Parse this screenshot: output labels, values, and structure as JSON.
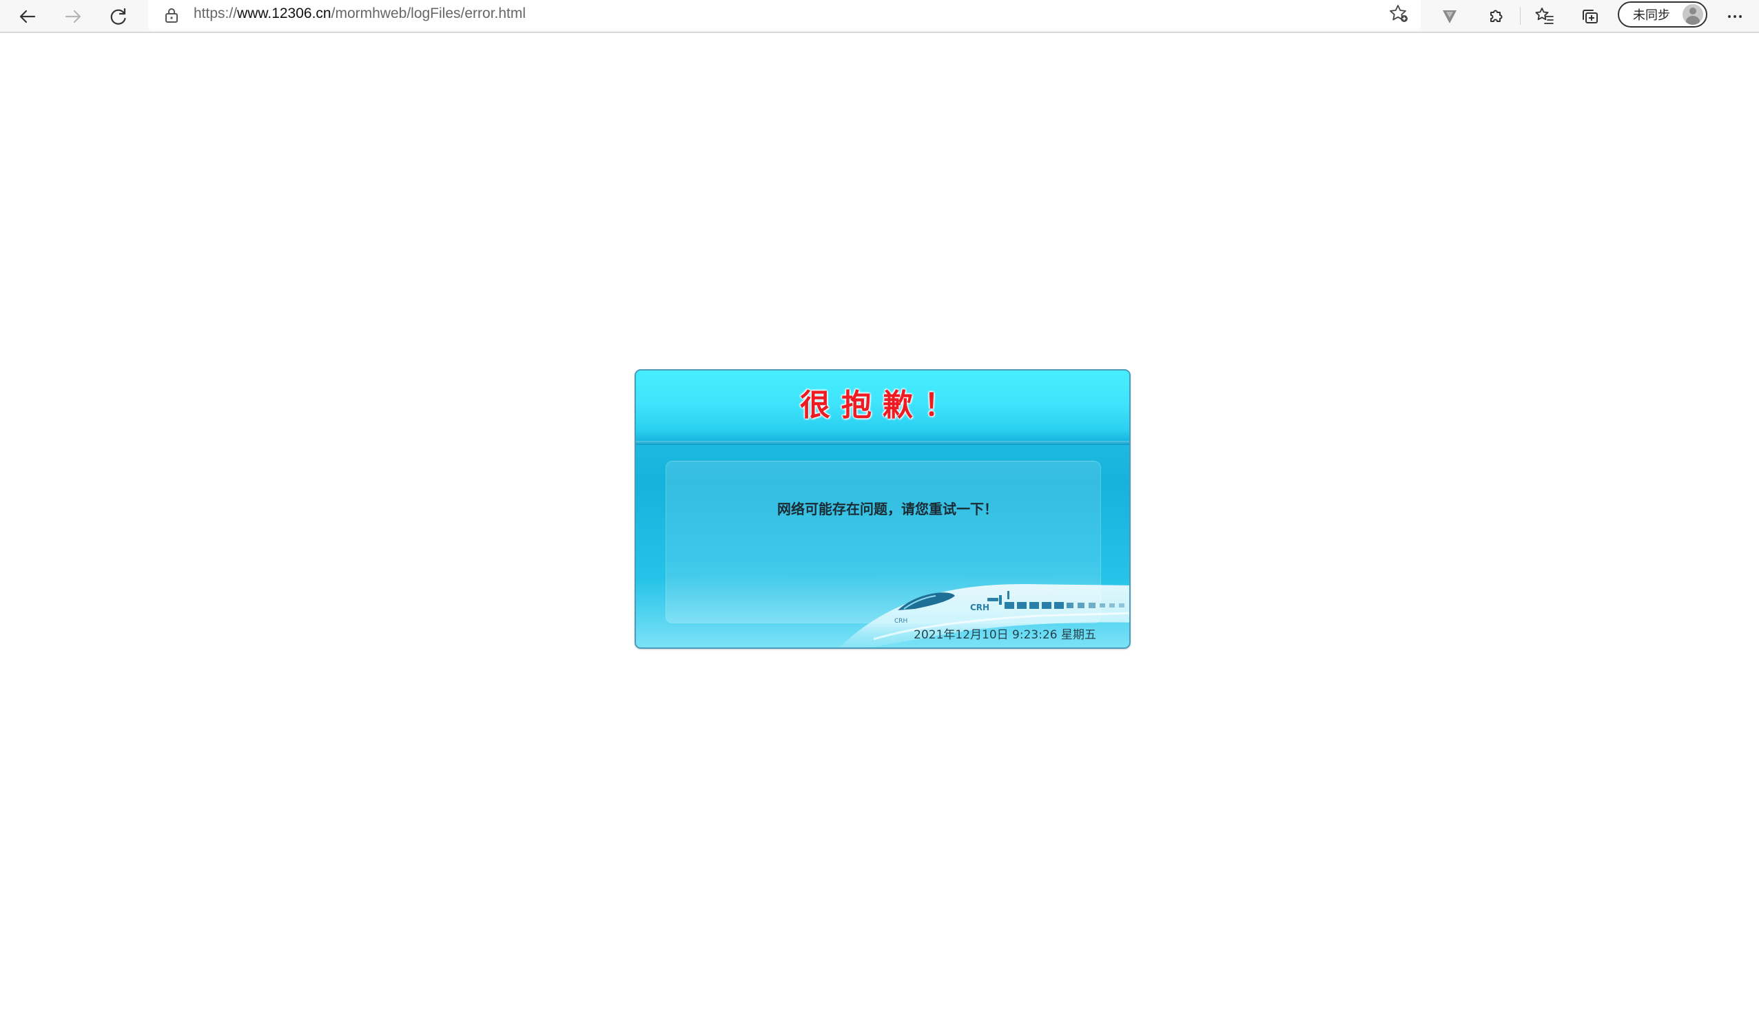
{
  "browser": {
    "url_scheme": "https://",
    "url_host": "www.12306.cn",
    "url_path": "/mormhweb/logFiles/error.html",
    "profile_label": "未同步",
    "icons": [
      "back-arrow-icon",
      "forward-arrow-icon",
      "refresh-icon",
      "lock-icon",
      "add-favorite-star-icon",
      "extension-v-icon",
      "extensions-puzzle-icon",
      "favorites-icon",
      "collections-icon",
      "profile-avatar-icon",
      "more-menu-icon"
    ]
  },
  "error_card": {
    "title": "很抱歉！",
    "message": "网络可能存在问题，请您重试一下！",
    "datetime": "2021年12月10日 9:23:26 星期五",
    "colors": {
      "title": "#ee1c22",
      "card_top": "#46eefe",
      "card_body": "#15b3dc"
    }
  }
}
